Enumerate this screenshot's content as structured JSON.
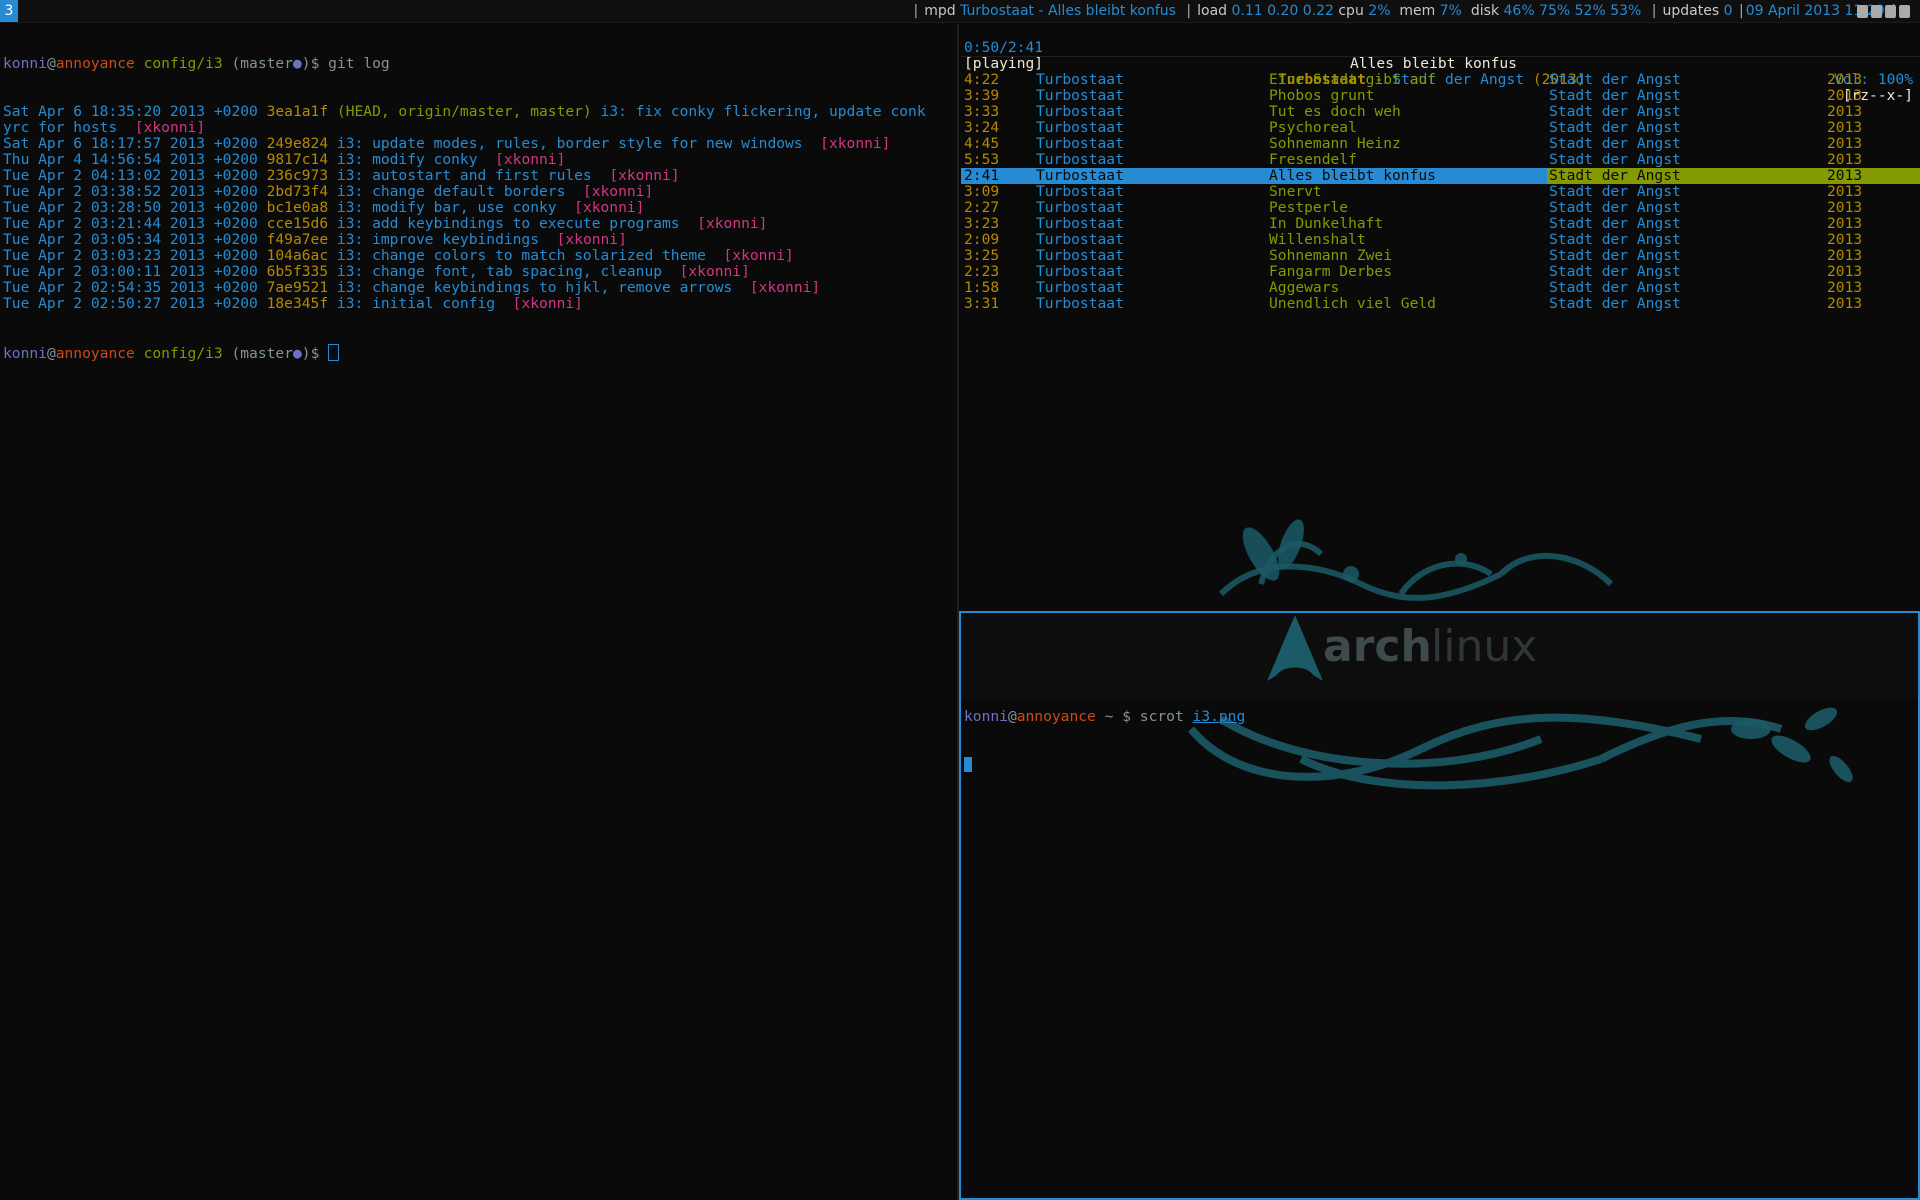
{
  "bar": {
    "workspace": "3",
    "mpd_label": "mpd",
    "mpd_now": "Turbostaat - Alles bleibt konfus",
    "load_label": "load",
    "load_values": "0.11 0.20 0.22",
    "cpu_label": "cpu",
    "cpu_value": "2%",
    "mem_label": "mem",
    "mem_value": "7%",
    "disk_label": "disk",
    "disk_values": "46% 75% 52% 53%",
    "updates_label": "updates",
    "updates_value": "0",
    "datetime": "09 April 2013 11:29",
    "accent": "#268bd2"
  },
  "left_term": {
    "prompt_user": "konni",
    "prompt_at": "@",
    "prompt_host": "annoyance",
    "prompt_path": "config/i3",
    "prompt_branch": "(master",
    "prompt_dot": "●",
    "prompt_tail": ")$",
    "command": "git log",
    "commits": [
      {
        "date": "Sat Apr 6 18:35:20 2013 +0200",
        "hash": "3ea1a1f",
        "refs": "(HEAD, origin/master, master)",
        "msg": "i3: fix conky flickering, update conk",
        "msg2": "yrc for hosts",
        "author": "[xkonni]"
      },
      {
        "date": "Sat Apr 6 18:17:57 2013 +0200",
        "hash": "249e824",
        "refs": "",
        "msg": "i3: update modes, rules, border style for new windows",
        "msg2": "",
        "author": "[xkonni]"
      },
      {
        "date": "Thu Apr 4 14:56:54 2013 +0200",
        "hash": "9817c14",
        "refs": "",
        "msg": "i3: modify conky",
        "msg2": "",
        "author": "[xkonni]"
      },
      {
        "date": "Tue Apr 2 04:13:02 2013 +0200",
        "hash": "236c973",
        "refs": "",
        "msg": "i3: autostart and first rules",
        "msg2": "",
        "author": "[xkonni]"
      },
      {
        "date": "Tue Apr 2 03:38:52 2013 +0200",
        "hash": "2bd73f4",
        "refs": "",
        "msg": "i3: change default borders",
        "msg2": "",
        "author": "[xkonni]"
      },
      {
        "date": "Tue Apr 2 03:28:50 2013 +0200",
        "hash": "bc1e0a8",
        "refs": "",
        "msg": "i3: modify bar, use conky",
        "msg2": "",
        "author": "[xkonni]"
      },
      {
        "date": "Tue Apr 2 03:21:44 2013 +0200",
        "hash": "cce15d6",
        "refs": "",
        "msg": "i3: add keybindings to execute programs",
        "msg2": "",
        "author": "[xkonni]"
      },
      {
        "date": "Tue Apr 2 03:05:34 2013 +0200",
        "hash": "f49a7ee",
        "refs": "",
        "msg": "i3: improve keybindings",
        "msg2": "",
        "author": "[xkonni]"
      },
      {
        "date": "Tue Apr 2 03:03:23 2013 +0200",
        "hash": "104a6ac",
        "refs": "",
        "msg": "i3: change colors to match solarized theme",
        "msg2": "",
        "author": "[xkonni]"
      },
      {
        "date": "Tue Apr 2 03:00:11 2013 +0200",
        "hash": "6b5f335",
        "refs": "",
        "msg": "i3: change font, tab spacing, cleanup",
        "msg2": "",
        "author": "[xkonni]"
      },
      {
        "date": "Tue Apr 2 02:54:35 2013 +0200",
        "hash": "7ae9521",
        "refs": "",
        "msg": "i3: change keybindings to hjkl, remove arrows",
        "msg2": "",
        "author": "[xkonni]"
      },
      {
        "date": "Tue Apr 2 02:50:27 2013 +0200",
        "hash": "18e345f",
        "refs": "",
        "msg": "i3: initial config",
        "msg2": "",
        "author": "[xkonni]"
      }
    ]
  },
  "mpd": {
    "elapsed": "0:50/2:41",
    "current_title": "Alles bleibt konfus",
    "volume": "Vol: 100%",
    "state": "[playing]",
    "current_artist": "Turbostaat",
    "dash": " - ",
    "current_album": "Stadt der Angst",
    "current_year": "(2013)",
    "flags": "[rz--x-]",
    "playlist": [
      {
        "time": "4:22",
        "artist": "Turbostaat",
        "title": "Eine Stadt gibt auf",
        "album": "Stadt der Angst",
        "year": "2013"
      },
      {
        "time": "3:39",
        "artist": "Turbostaat",
        "title": "Phobos grunt",
        "album": "Stadt der Angst",
        "year": "2013"
      },
      {
        "time": "3:33",
        "artist": "Turbostaat",
        "title": "Tut es doch weh",
        "album": "Stadt der Angst",
        "year": "2013"
      },
      {
        "time": "3:24",
        "artist": "Turbostaat",
        "title": "Psychoreal",
        "album": "Stadt der Angst",
        "year": "2013"
      },
      {
        "time": "4:45",
        "artist": "Turbostaat",
        "title": "Sohnemann Heinz",
        "album": "Stadt der Angst",
        "year": "2013"
      },
      {
        "time": "5:53",
        "artist": "Turbostaat",
        "title": "Fresendelf",
        "album": "Stadt der Angst",
        "year": "2013"
      },
      {
        "time": "2:41",
        "artist": "Turbostaat",
        "title": "Alles bleibt konfus",
        "album": "Stadt der Angst",
        "year": "2013",
        "selected": true
      },
      {
        "time": "3:09",
        "artist": "Turbostaat",
        "title": "Snervt",
        "album": "Stadt der Angst",
        "year": "2013"
      },
      {
        "time": "2:27",
        "artist": "Turbostaat",
        "title": "Pestperle",
        "album": "Stadt der Angst",
        "year": "2013"
      },
      {
        "time": "3:23",
        "artist": "Turbostaat",
        "title": "In Dunkelhaft",
        "album": "Stadt der Angst",
        "year": "2013"
      },
      {
        "time": "2:09",
        "artist": "Turbostaat",
        "title": "Willenshalt",
        "album": "Stadt der Angst",
        "year": "2013"
      },
      {
        "time": "3:25",
        "artist": "Turbostaat",
        "title": "Sohnemann Zwei",
        "album": "Stadt der Angst",
        "year": "2013"
      },
      {
        "time": "2:23",
        "artist": "Turbostaat",
        "title": "Fangarm Derbes",
        "album": "Stadt der Angst",
        "year": "2013"
      },
      {
        "time": "1:58",
        "artist": "Turbostaat",
        "title": "Aggewars",
        "album": "Stadt der Angst",
        "year": "2013"
      },
      {
        "time": "3:31",
        "artist": "Turbostaat",
        "title": "Unendlich viel Geld",
        "album": "Stadt der Angst",
        "year": "2013"
      }
    ]
  },
  "right_term": {
    "prompt_user": "konni",
    "prompt_at": "@",
    "prompt_host": "annoyance",
    "prompt_path": "~",
    "prompt_symbol": "$",
    "command": "scrot",
    "arg": "i3.png"
  },
  "wallpaper": {
    "logo_text_a": "arch",
    "logo_text_b": "linux",
    "color": "#1b5a66"
  }
}
